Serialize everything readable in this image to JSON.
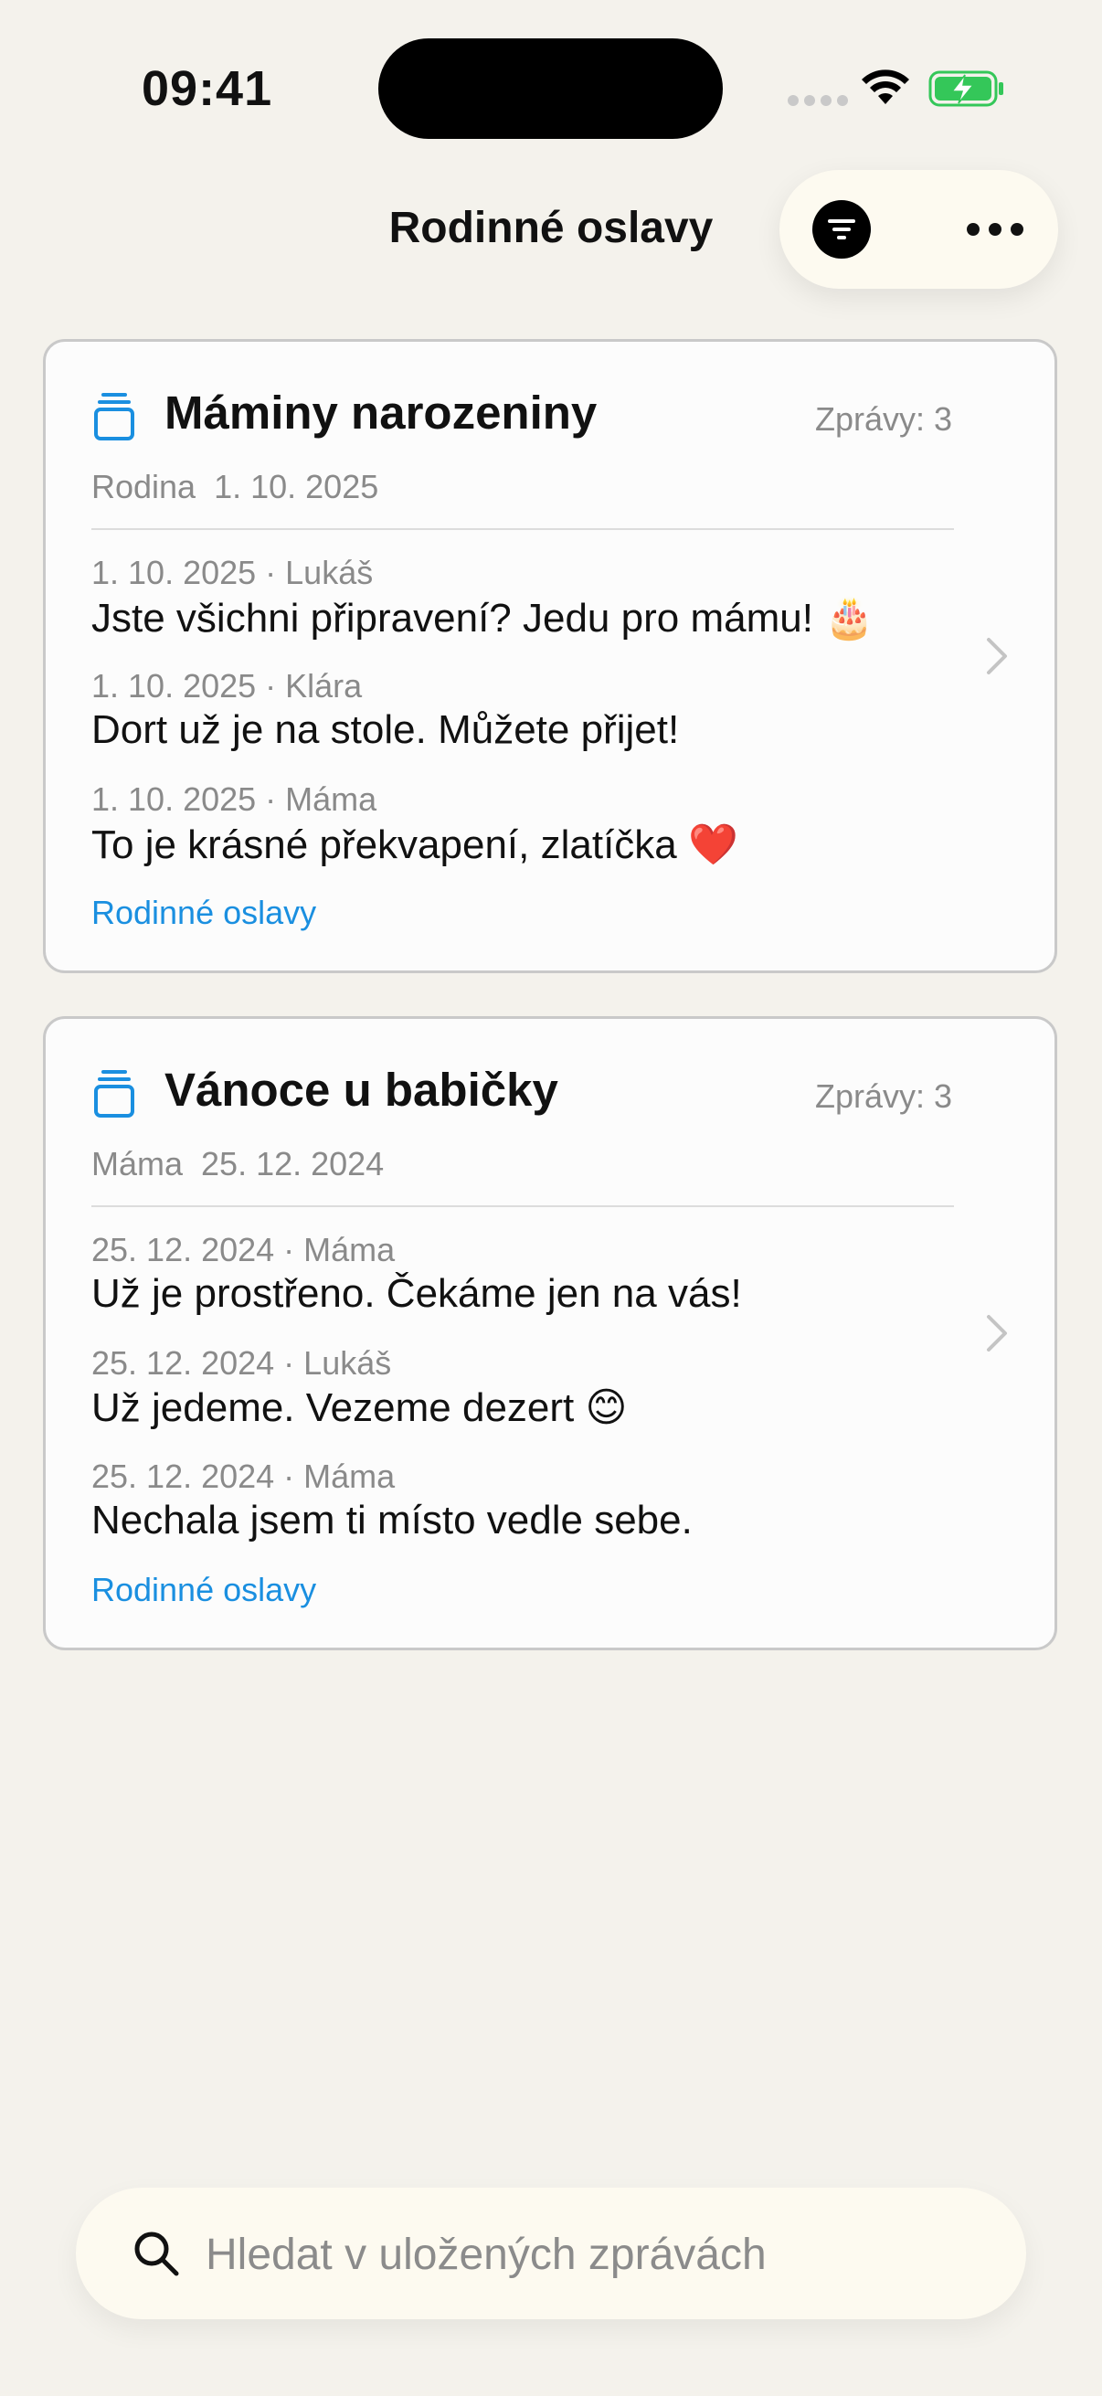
{
  "status_bar": {
    "time": "09:41"
  },
  "header": {
    "title": "Rodinné oslavy",
    "filter_icon": "filter-icon",
    "more_icon": "more-icon"
  },
  "cards": [
    {
      "title": "Máminy narozeniny",
      "count": "Zprávy: 3",
      "subtitle": "Rodina  1. 10. 2025",
      "messages": [
        {
          "meta": "1. 10. 2025 · Lukáš",
          "text": "Jste všichni připravení? Jedu pro mámu! 🎂"
        },
        {
          "meta": "1. 10. 2025 · Klára",
          "text": "Dort už je na stole. Můžete přijet!"
        },
        {
          "meta": "1. 10. 2025 · Máma",
          "text": "To je krásné překvapení, zlatíčka ❤️"
        }
      ],
      "link": "Rodinné oslavy"
    },
    {
      "title": "Vánoce u babičky",
      "count": "Zprávy: 3",
      "subtitle": "Máma  25. 12. 2024",
      "messages": [
        {
          "meta": "25. 12. 2024 · Máma",
          "text": "Už je prostřeno. Čekáme jen na vás!"
        },
        {
          "meta": "25. 12. 2024 · Lukáš",
          "text": "Už jedeme. Vezeme dezert 😊"
        },
        {
          "meta": "25. 12. 2024 · Máma",
          "text": "Nechala jsem ti místo vedle sebe."
        }
      ],
      "link": "Rodinné oslavy"
    }
  ],
  "search": {
    "placeholder": "Hledat v uložených zprávách",
    "value": ""
  },
  "colors": {
    "background": "#f4f2ec",
    "accent": "#1a8fe0",
    "battery": "#34c759"
  }
}
